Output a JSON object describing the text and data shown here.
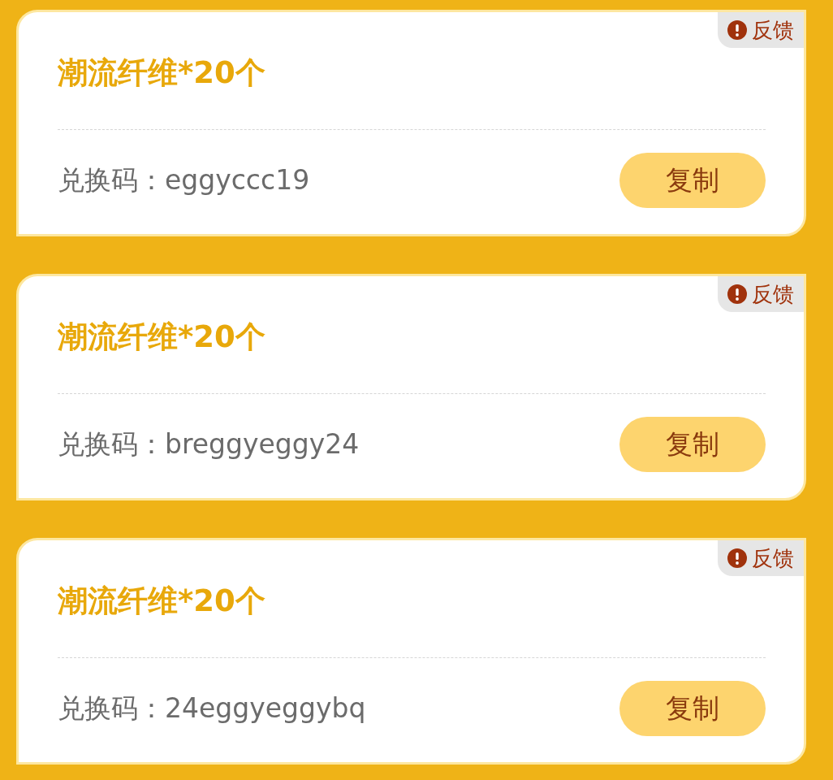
{
  "cards": [
    {
      "feedback": "反馈",
      "title": "潮流纤维*20个",
      "code_label": "兑换码：",
      "code": "eggyccc19",
      "button": "复制"
    },
    {
      "feedback": "反馈",
      "title": "潮流纤维*20个",
      "code_label": "兑换码：",
      "code": "breggyeggy24",
      "button": "复制"
    },
    {
      "feedback": "反馈",
      "title": "潮流纤维*20个",
      "code_label": "兑换码：",
      "code": "24eggyeggybq",
      "button": "复制"
    }
  ]
}
